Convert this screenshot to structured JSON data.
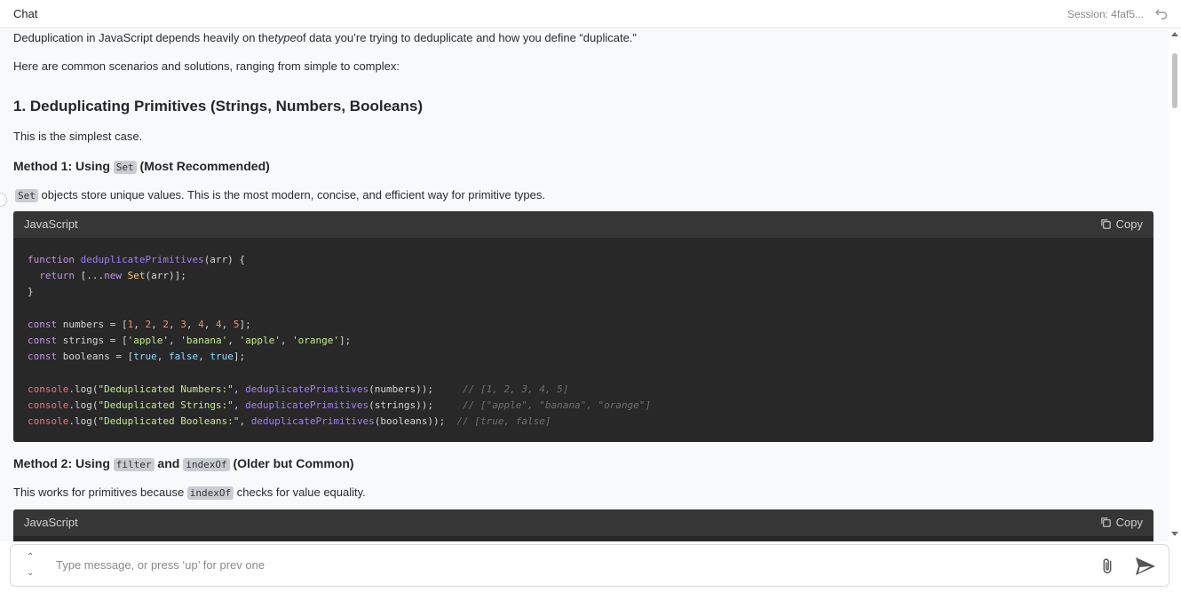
{
  "header": {
    "title": "Chat",
    "session": "Session: 4faf5..."
  },
  "content": {
    "intro_pre": "Deduplication in JavaScript depends heavily on the",
    "intro_em": "type",
    "intro_post": "of data you’re trying to deduplicate and how you define “duplicate.”",
    "scenarios": "Here are common scenarios and solutions, ranging from simple to complex:",
    "h1": "1. Deduplicating Primitives (Strings, Numbers, Booleans)",
    "simplest": "This is the simplest case.",
    "m1_pre": "Method 1: Using",
    "m1_code": "Set",
    "m1_post": "(Most Recommended)",
    "set_code": "Set",
    "set_desc": "objects store unique values. This is the most modern, concise, and efficient way for primitive types.",
    "code1": {
      "lang": "JavaScript",
      "copy": "Copy",
      "l1_kw": "function",
      "l1_fn": "deduplicatePrimitives",
      "l1_rest": "(arr) {",
      "l2_kw1": "return",
      "l2_mid": " [...",
      "l2_kw2": "new",
      "l2_cls": "Set",
      "l2_rest": "(arr)];",
      "l3": "}",
      "c": "const",
      "numbers_decl": " numbers = [",
      "n1": "1",
      "n2": "2",
      "n3": "2",
      "n4": "3",
      "n5": "4",
      "n6": "4",
      "n7": "5",
      "strings_decl": " strings = [",
      "s1": "'apple'",
      "s2": "'banana'",
      "s3": "'apple'",
      "s4": "'orange'",
      "booleans_decl": " booleans = [",
      "b1": "true",
      "b2": "false",
      "b3": "true",
      "console": "console",
      "log": ".log(",
      "lbl1": "\"Deduplicated Numbers:\"",
      "lbl2": "\"Deduplicated Strings:\"",
      "lbl3": "\"Deduplicated Booleans:\"",
      "dp": "deduplicatePrimitives",
      "arg1": "(numbers));",
      "arg2": "(strings));",
      "arg3": "(booleans));",
      "cm1": "// [1, 2, 3, 4, 5]",
      "cm2": "// [\"apple\", \"banana\", \"orange\"]",
      "cm3": "// [true, false]"
    },
    "m2_pre": "Method 2: Using",
    "m2_code1": "filter",
    "m2_and": "and",
    "m2_code2": "indexOf",
    "m2_post": "(Older but Common)",
    "works_pre": "This works for primitives because",
    "works_code": "indexOf",
    "works_post": "checks for value equality.",
    "code2": {
      "lang": "JavaScript",
      "copy": "Copy"
    }
  },
  "input": {
    "placeholder": "Type message, or press ‘up’ for prev one"
  }
}
